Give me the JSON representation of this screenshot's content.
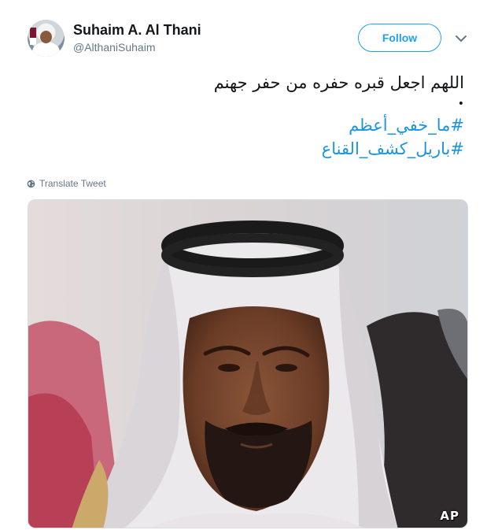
{
  "tweet": {
    "author": {
      "display_name": "Suhaim A. Al Thani",
      "handle": "@AlthaniSuhaim"
    },
    "follow_label": "Follow",
    "body_line": "اللهم اجعل قبره حفره من حفر جهنم",
    "bullet": "•",
    "hashtags": [
      "#ما_خفي_أعظم",
      "#باريل_كشف_القناع"
    ],
    "translate_label": "Translate Tweet",
    "media": {
      "description_icon": "photo",
      "watermark": "AP"
    }
  },
  "colors": {
    "accent": "#1da1f2",
    "hashtag": "#1b95e0",
    "muted": "#657786",
    "text": "#14171a"
  },
  "icons": {
    "more": "chevron-down-icon",
    "translate": "globe-icon"
  }
}
